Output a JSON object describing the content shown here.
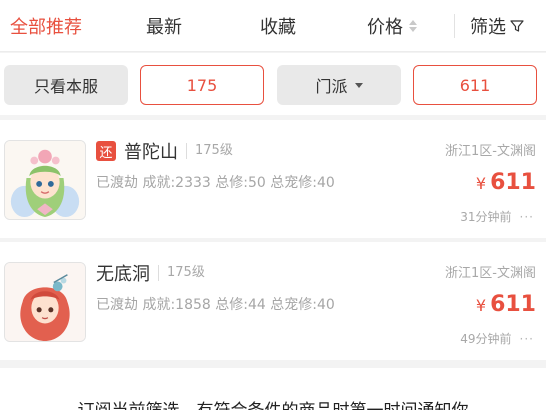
{
  "sortbar": {
    "items": [
      {
        "label": "全部推荐",
        "active": true
      },
      {
        "label": "最新",
        "active": false
      },
      {
        "label": "收藏",
        "active": false
      },
      {
        "label": "价格",
        "active": false
      }
    ],
    "filter_label": "筛选",
    "accent_color": "#e8503f"
  },
  "chips": {
    "server_only": "只看本服",
    "level": "175",
    "sect": "门派",
    "price": "611"
  },
  "listings": [
    {
      "tag": "还",
      "school": "普陀山",
      "level": "175级",
      "desc": "已渡劫 成就:2333 总修:50 总宠修:40",
      "server": "浙江1区-文渊阁",
      "currency": "¥",
      "price": "611",
      "time": "31分钟前",
      "more": "···"
    },
    {
      "tag": "",
      "school": "无底洞",
      "level": "175级",
      "desc": "已渡劫 成就:1858 总修:44 总宠修:40",
      "server": "浙江1区-文渊阁",
      "currency": "¥",
      "price": "611",
      "time": "49分钟前",
      "more": "···"
    }
  ],
  "notice": {
    "text": "订阅当前筛选，有符合条件的商品时第一时间通知你"
  }
}
